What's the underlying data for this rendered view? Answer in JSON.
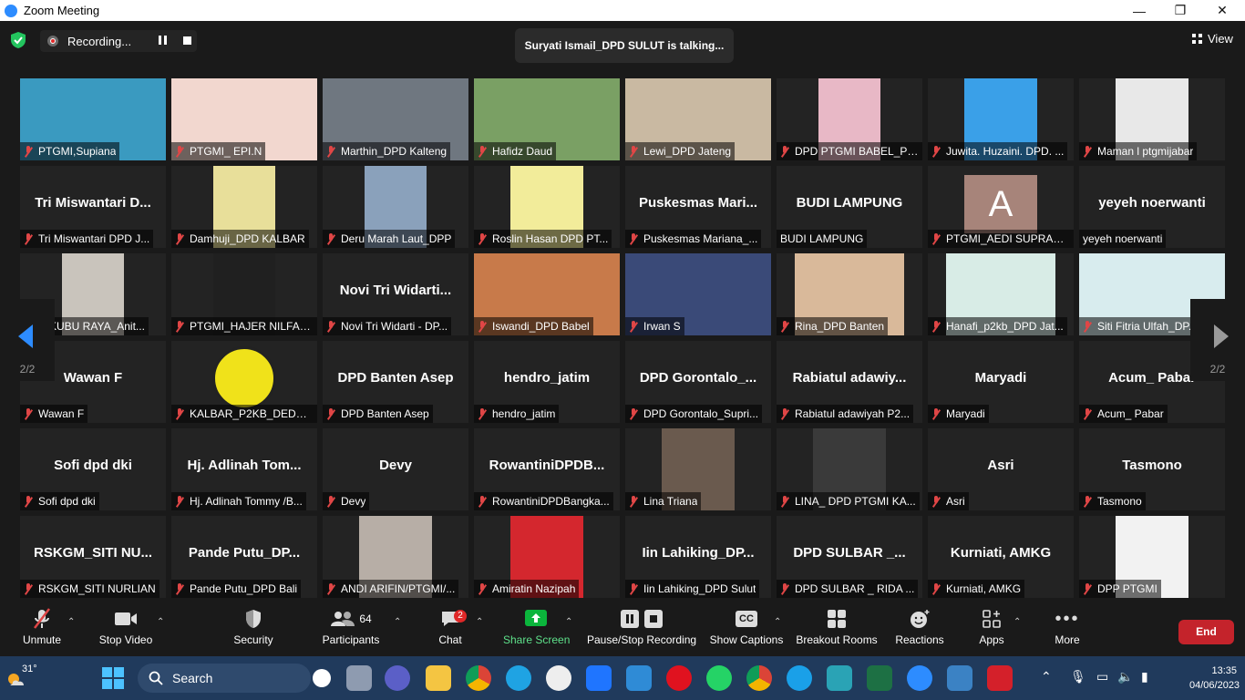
{
  "window": {
    "title": "Zoom Meeting"
  },
  "meeting": {
    "recording_label": "Recording...",
    "talking": "Suryati Ismail_DPD SULUT is talking...",
    "view_label": "View",
    "page_left": "2/2",
    "page_right": "2/2"
  },
  "tiles": [
    {
      "label": "PTGMI,Supiana",
      "big": ""
    },
    {
      "label": "PTGMI_ EPI.N",
      "big": ""
    },
    {
      "label": "Marthin_DPD Kalteng",
      "big": ""
    },
    {
      "label": "Hafidz Daud",
      "big": ""
    },
    {
      "label": "Lewi_DPD Jateng",
      "big": ""
    },
    {
      "label": "DPD PTGMI BABEL_P2...",
      "big": ""
    },
    {
      "label": "Juwita. Huzaini. DPD. ...",
      "big": ""
    },
    {
      "label": "Maman l ptgmijabar",
      "big": ""
    },
    {
      "label": "Tri Miswantari DPD J...",
      "big": "Tri Miswantari D..."
    },
    {
      "label": "Damhuji_DPD KALBAR",
      "big": ""
    },
    {
      "label": "Deru Marah Laut_DPP",
      "big": ""
    },
    {
      "label": "Roslin Hasan DPD PT...",
      "big": ""
    },
    {
      "label": "Puskesmas Mariana_...",
      "big": "Puskesmas  Mari..."
    },
    {
      "label": "BUDI LAMPUNG",
      "big": "BUDI LAMPUNG"
    },
    {
      "label": "PTGMI_AEDI SUPRADI...",
      "big": "",
      "avatar": "A"
    },
    {
      "label": "yeyeh noerwanti",
      "big": "yeyeh noerwanti"
    },
    {
      "label": "C KUBU RAYA_Anit...",
      "big": ""
    },
    {
      "label": "PTGMI_HAJER NILFAD...",
      "big": ""
    },
    {
      "label": "Novi Tri Widarti - DP...",
      "big": "Novi Tri Widarti..."
    },
    {
      "label": "Iswandi_DPD Babel",
      "big": ""
    },
    {
      "label": "Irwan S",
      "big": ""
    },
    {
      "label": "Rina_DPD Banten",
      "big": ""
    },
    {
      "label": "Hanafi_p2kb_DPD Jat...",
      "big": ""
    },
    {
      "label": "Siti Fitria Ulfah_DP...",
      "big": ""
    },
    {
      "label": "Wawan F",
      "big": "Wawan F"
    },
    {
      "label": "KALBAR_P2KB_DEDE ...",
      "big": ""
    },
    {
      "label": "DPD Banten Asep",
      "big": "DPD Banten Asep"
    },
    {
      "label": "hendro_jatim",
      "big": "hendro_jatim"
    },
    {
      "label": "DPD Gorontalo_Supri...",
      "big": "DPD  Gorontalo_..."
    },
    {
      "label": "Rabiatul adawiyah P2...",
      "big": "Rabiatul  adawiy..."
    },
    {
      "label": "Maryadi",
      "big": "Maryadi"
    },
    {
      "label": "Acum_ Pabar",
      "big": "Acum_ Pabar"
    },
    {
      "label": "Sofi  dpd dki",
      "big": "Sofi  dpd dki"
    },
    {
      "label": "Hj. Adlinah Tommy /B...",
      "big": "Hj.  Adlinah  Tom..."
    },
    {
      "label": "Devy",
      "big": "Devy"
    },
    {
      "label": "RowantiniDPDBangka...",
      "big": "RowantiniDPDB..."
    },
    {
      "label": "Lina Triana",
      "big": ""
    },
    {
      "label": "LINA_ DPD PTGMI KA...",
      "big": ""
    },
    {
      "label": "Asri",
      "big": "Asri"
    },
    {
      "label": "Tasmono",
      "big": "Tasmono"
    },
    {
      "label": "RSKGM_SITI NURLIAN",
      "big": "RSKGM_SITI  NU..."
    },
    {
      "label": "Pande Putu_DPD Bali",
      "big": "Pande  Putu_DP..."
    },
    {
      "label": "ANDI ARIFIN/PTGMI/...",
      "big": ""
    },
    {
      "label": "Amiratin Nazipah",
      "big": ""
    },
    {
      "label": "Iin Lahiking_DPD Sulut",
      "big": "Iin  Lahiking_DP..."
    },
    {
      "label": "DPD SULBAR _ RIDA ...",
      "big": "DPD  SULBAR  _..."
    },
    {
      "label": "Kurniati, AMKG",
      "big": "Kurniati, AMKG"
    },
    {
      "label": "DPP PTGMI",
      "big": ""
    }
  ],
  "toolbar": {
    "unmute": "Unmute",
    "stop_video": "Stop Video",
    "security": "Security",
    "participants": "Participants",
    "participants_count": "64",
    "chat": "Chat",
    "chat_badge": "2",
    "share_screen": "Share Screen",
    "pause_stop": "Pause/Stop Recording",
    "show_captions": "Show Captions",
    "breakout": "Breakout Rooms",
    "reactions": "Reactions",
    "apps": "Apps",
    "more": "More",
    "end": "End",
    "cc_icon_text": "CC"
  },
  "taskbar": {
    "temperature": "31°",
    "search": "Search",
    "time": "13:35",
    "date": "04/06/2023"
  },
  "colors": {
    "accent": "#2d8cff",
    "end": "#c4232b",
    "share": "#0bb53c",
    "mic_off": "#e04646"
  }
}
